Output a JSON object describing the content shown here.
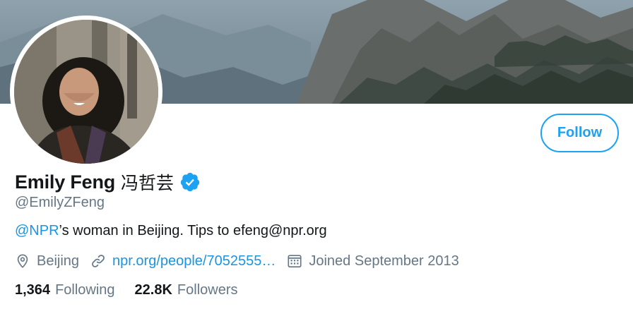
{
  "banner": {
    "alt": "mountain landscape header"
  },
  "profile": {
    "display_name": "Emily Feng",
    "cjk_name": "冯哲芸",
    "handle": "@EmilyZFeng",
    "verified_icon": "verified-badge-icon"
  },
  "follow_button": {
    "label": "Follow"
  },
  "bio": {
    "mention": "@NPR",
    "text": "’s woman in Beijing. Tips to efeng@npr.org"
  },
  "meta": {
    "location": "Beijing",
    "location_icon": "location-pin-icon",
    "website": "npr.org/people/7052555…",
    "website_icon": "link-icon",
    "joined": "Joined September 2013",
    "joined_icon": "calendar-icon"
  },
  "stats": {
    "following_count": "1,364",
    "following_label": "Following",
    "followers_count": "22.8K",
    "followers_label": "Followers"
  },
  "colors": {
    "accent": "#1da1f2",
    "link": "#1b95e0",
    "muted": "#657786",
    "text": "#14171a"
  }
}
